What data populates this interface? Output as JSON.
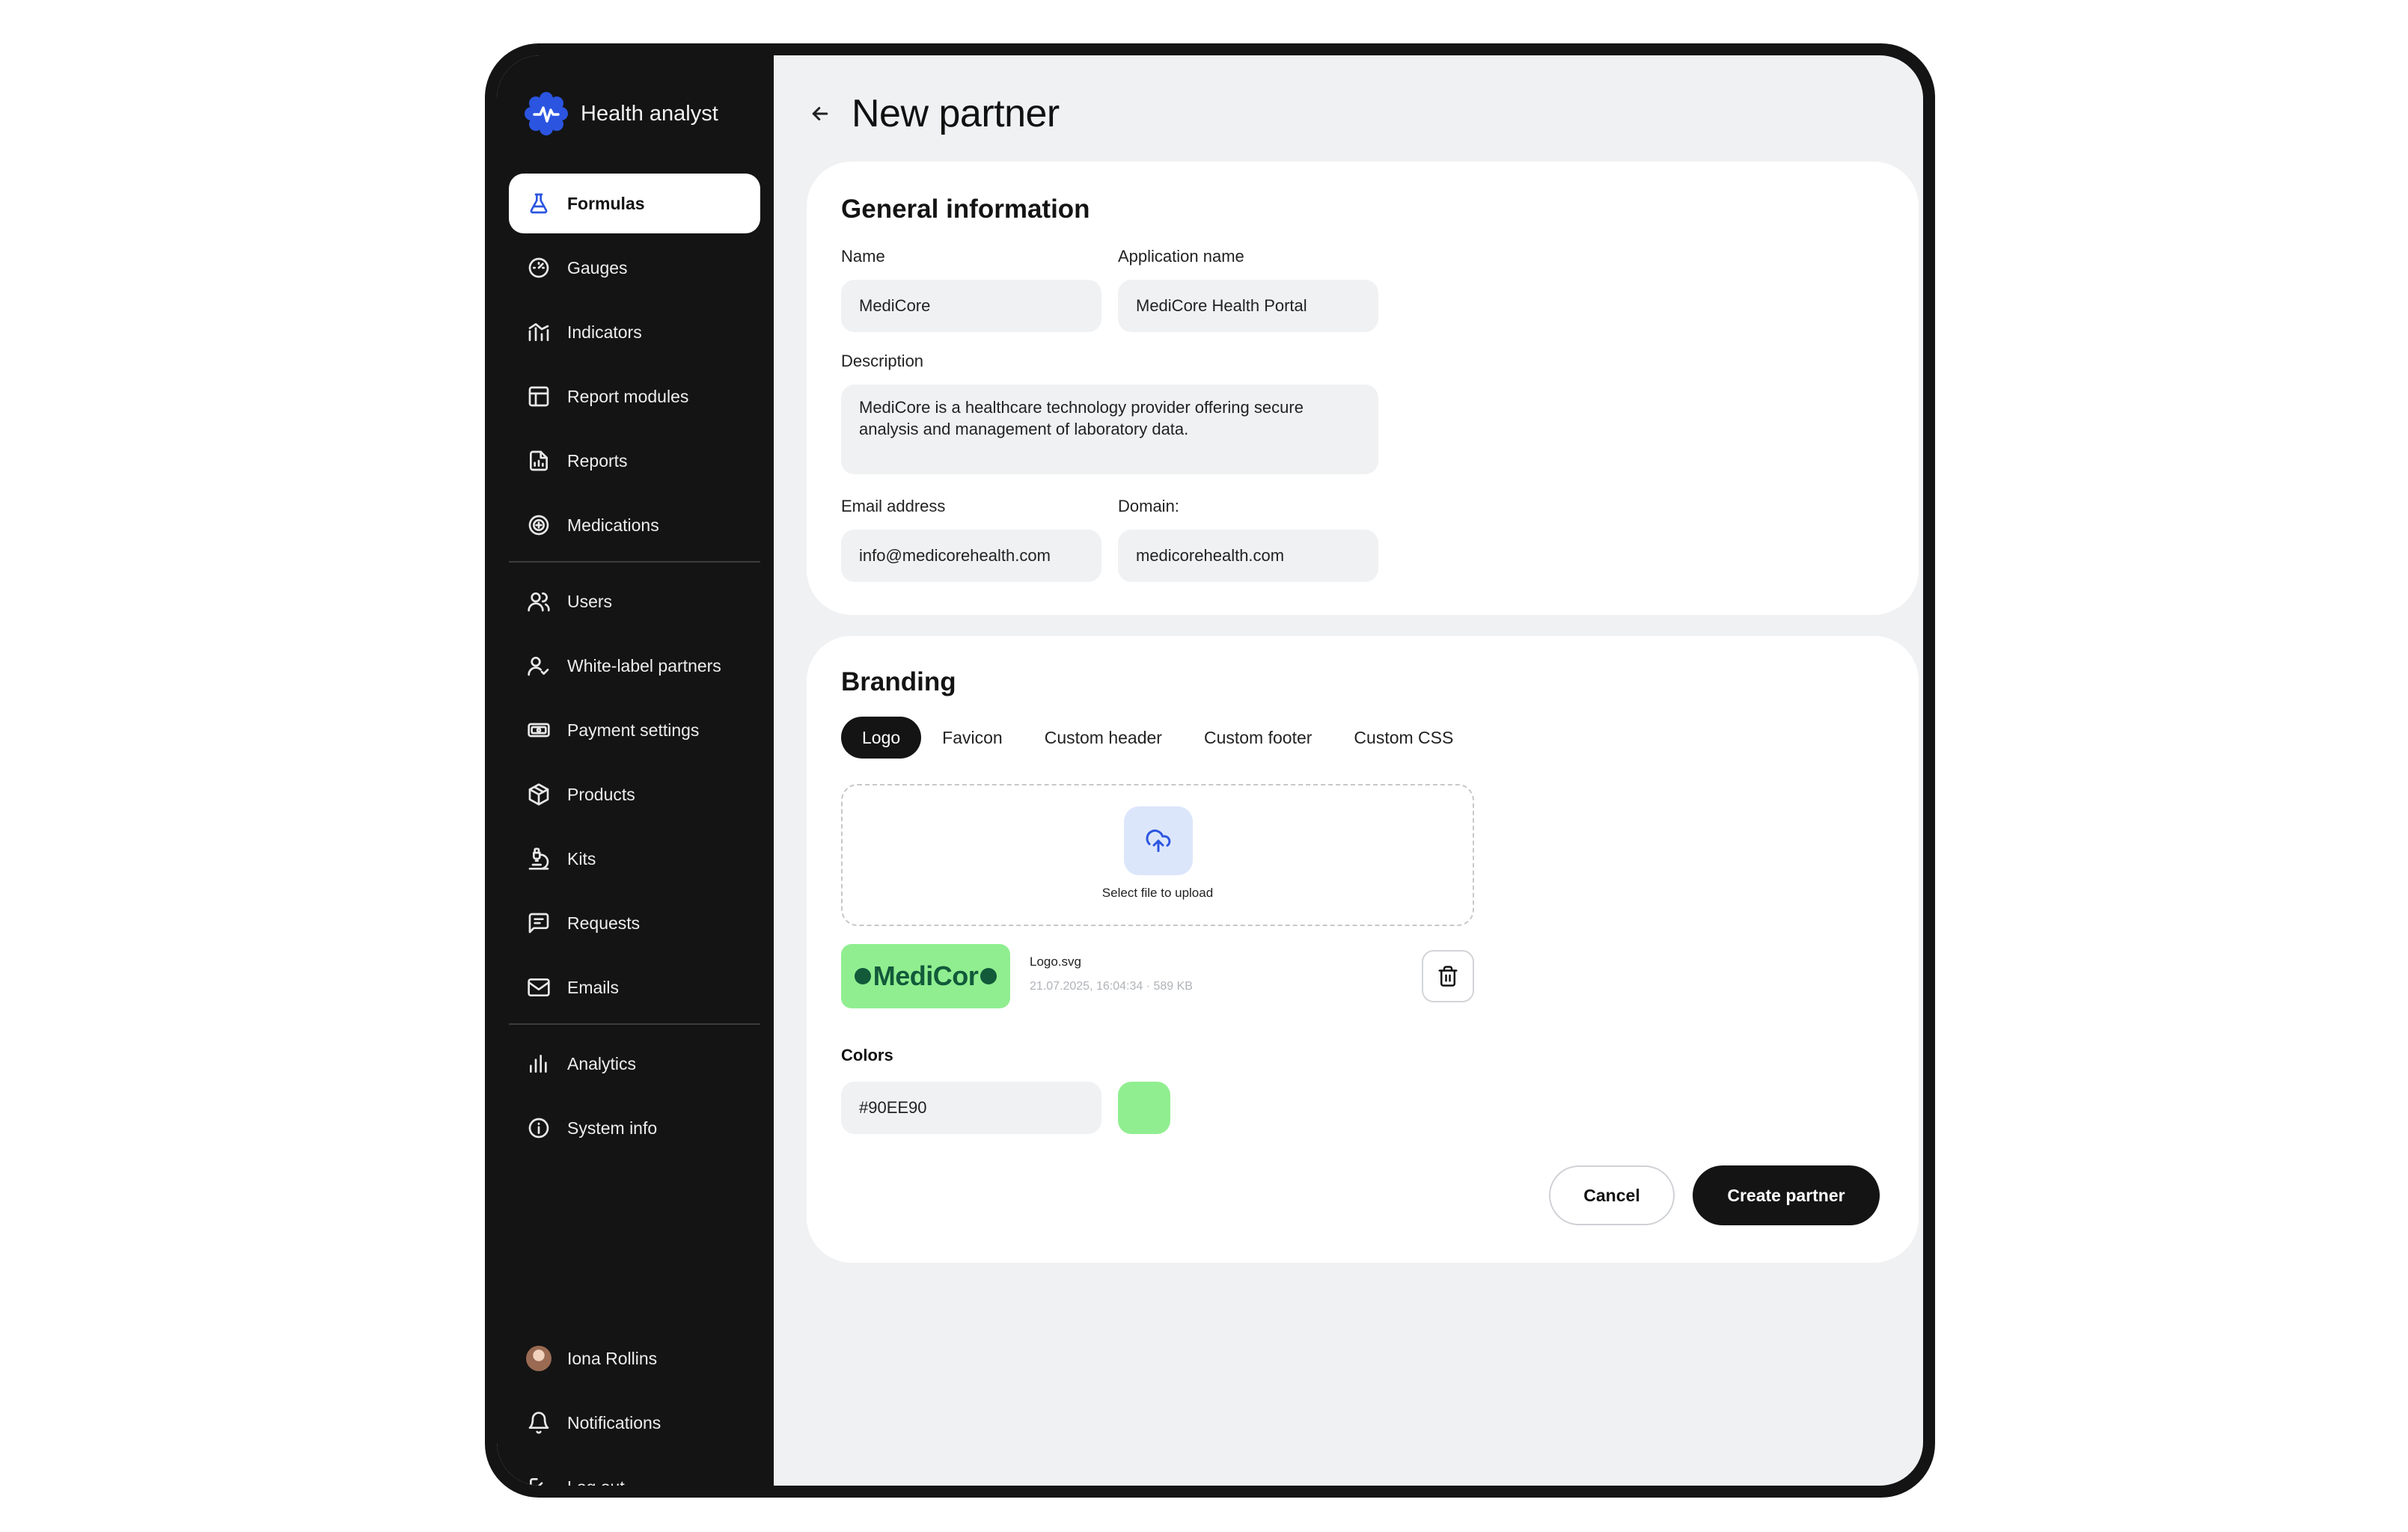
{
  "app": {
    "name": "Health analyst"
  },
  "sidebar": {
    "items": [
      {
        "label": "Formulas",
        "icon": "flask-icon"
      },
      {
        "label": "Gauges",
        "icon": "gauge-icon"
      },
      {
        "label": "Indicators",
        "icon": "indicator-chart-icon"
      },
      {
        "label": "Report modules",
        "icon": "layout-icon"
      },
      {
        "label": "Reports",
        "icon": "report-file-icon"
      },
      {
        "label": "Medications",
        "icon": "medication-icon"
      },
      {
        "label": "Users",
        "icon": "users-icon"
      },
      {
        "label": "White-label partners",
        "icon": "user-check-icon"
      },
      {
        "label": "Payment settings",
        "icon": "banknote-icon"
      },
      {
        "label": "Products",
        "icon": "box-icon"
      },
      {
        "label": "Kits",
        "icon": "microscope-icon"
      },
      {
        "label": "Requests",
        "icon": "message-square-icon"
      },
      {
        "label": "Emails",
        "icon": "mail-icon"
      },
      {
        "label": "Analytics",
        "icon": "bar-chart-icon"
      },
      {
        "label": "System info",
        "icon": "info-icon"
      }
    ],
    "active_item": "Formulas",
    "bottom": {
      "user": "Iona Rollins",
      "notifications": "Notifications",
      "logout": "Log out"
    }
  },
  "page": {
    "title": "New partner"
  },
  "general": {
    "title": "General information",
    "name_label": "Name",
    "name_value": "MediCore",
    "app_name_label": "Application name",
    "app_name_value": "MediCore Health Portal",
    "description_label": "Description",
    "description_line1": "MediCore is a healthcare technology provider offering secure",
    "description_line2": "analysis and management of laboratory data.",
    "email_label": "Email address",
    "email_value": "info@medicorehealth.com",
    "domain_label": "Domain:",
    "domain_value": "medicorehealth.com"
  },
  "branding": {
    "title": "Branding",
    "tabs": [
      "Logo",
      "Favicon",
      "Custom header",
      "Custom footer",
      "Custom CSS"
    ],
    "active_tab": "Logo",
    "upload_text": "Select file to upload",
    "logo_wordmark": "MediCor",
    "file_name": "Logo.svg",
    "file_meta": "21.07.2025, 16:04:34 · 589 KB",
    "colors_label": "Colors",
    "color_value": "#90EE90",
    "color_swatch": "#90ee90"
  },
  "actions": {
    "cancel": "Cancel",
    "create": "Create partner"
  },
  "theme": {
    "accent": "#2b55e0",
    "dark": "#141414",
    "surface": "#f0f1f3"
  }
}
